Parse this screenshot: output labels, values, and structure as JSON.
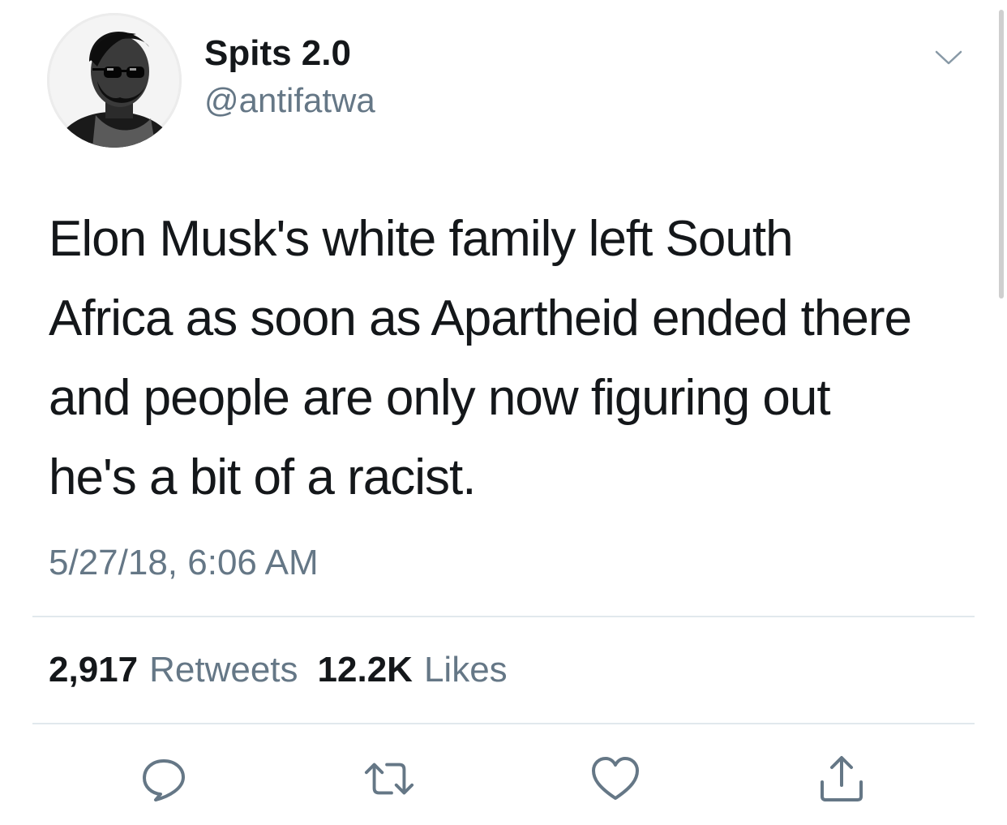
{
  "user": {
    "display_name": "Spits 2.0",
    "handle": "@antifatwa",
    "avatar_icon": "profile-photo"
  },
  "tweet": {
    "lines": [
      "Elon Musk's white family left South",
      "Africa as soon as Apartheid ended there",
      "and people are only now figuring out",
      "he's a bit of a racist."
    ],
    "timestamp": "5/27/18, 6:06 AM"
  },
  "stats": {
    "retweets_count": "2,917",
    "retweets_label": "Retweets",
    "likes_count": "12.2K",
    "likes_label": "Likes"
  },
  "actions": {
    "reply_icon": "reply-icon",
    "retweet_icon": "retweet-icon",
    "like_icon": "heart-icon",
    "share_icon": "share-icon"
  },
  "colors": {
    "text_primary": "#14171a",
    "text_secondary": "#657786",
    "icon": "#657786",
    "divider": "#e1e8ed"
  }
}
